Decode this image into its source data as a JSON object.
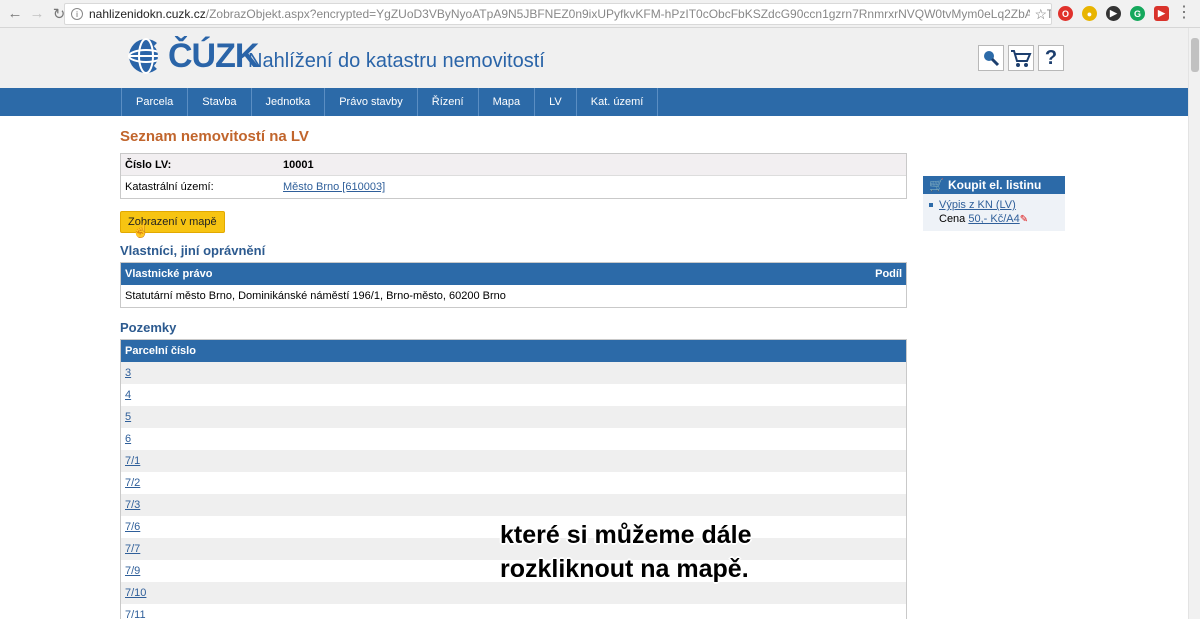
{
  "browser": {
    "url_host": "nahlizenidokn.cuzk.cz",
    "url_rest": "/ZobrazObjekt.aspx?encrypted=YgZUoD3VByNyoATpA9N5JBFNEZ0n9ixUPyfkvKFM-hPzIT0cObcFbKSZdcG90ccn1gzrn7RnmrxrNVQW0tvMym0eLq2ZbAadTeNWxpcscQPc..."
  },
  "header": {
    "logo_text": "ČÚZK",
    "site_title": "Nahlížení do katastru nemovitostí"
  },
  "nav": {
    "items": [
      "Parcela",
      "Stavba",
      "Jednotka",
      "Právo stavby",
      "Řízení",
      "Mapa",
      "LV",
      "Kat. území"
    ]
  },
  "main": {
    "title": "Seznam nemovitostí na LV",
    "lv_label": "Číslo LV:",
    "lv_value": "10001",
    "ku_label": "Katastrální území:",
    "ku_value": "Město Brno [610003]",
    "map_button": "Zobrazení v mapě",
    "owners_heading": "Vlastníci, jiní oprávnění",
    "owners_col1": "Vlastnické právo",
    "owners_col2": "Podíl",
    "owner": "Statutární město Brno, Dominikánské náměstí 196/1, Brno-město, 60200 Brno",
    "land_heading": "Pozemky",
    "land_col": "Parcelní číslo",
    "parcels": [
      "3",
      "4",
      "5",
      "6",
      "7/1",
      "7/2",
      "7/3",
      "7/6",
      "7/7",
      "7/9",
      "7/10",
      "7/11"
    ]
  },
  "sidebar": {
    "title": "Koupit el. listinu",
    "item": "Výpis z KN (LV)",
    "price_label": "Cena",
    "price_value": "50,- Kč/A4"
  },
  "subtitle": {
    "line1": "které si můžeme dále",
    "line2": "rozkliknout na mapě."
  },
  "colors": {
    "nav_blue": "#2c6aa8",
    "title_orange": "#c1652c",
    "button_yellow": "#f7c412"
  }
}
